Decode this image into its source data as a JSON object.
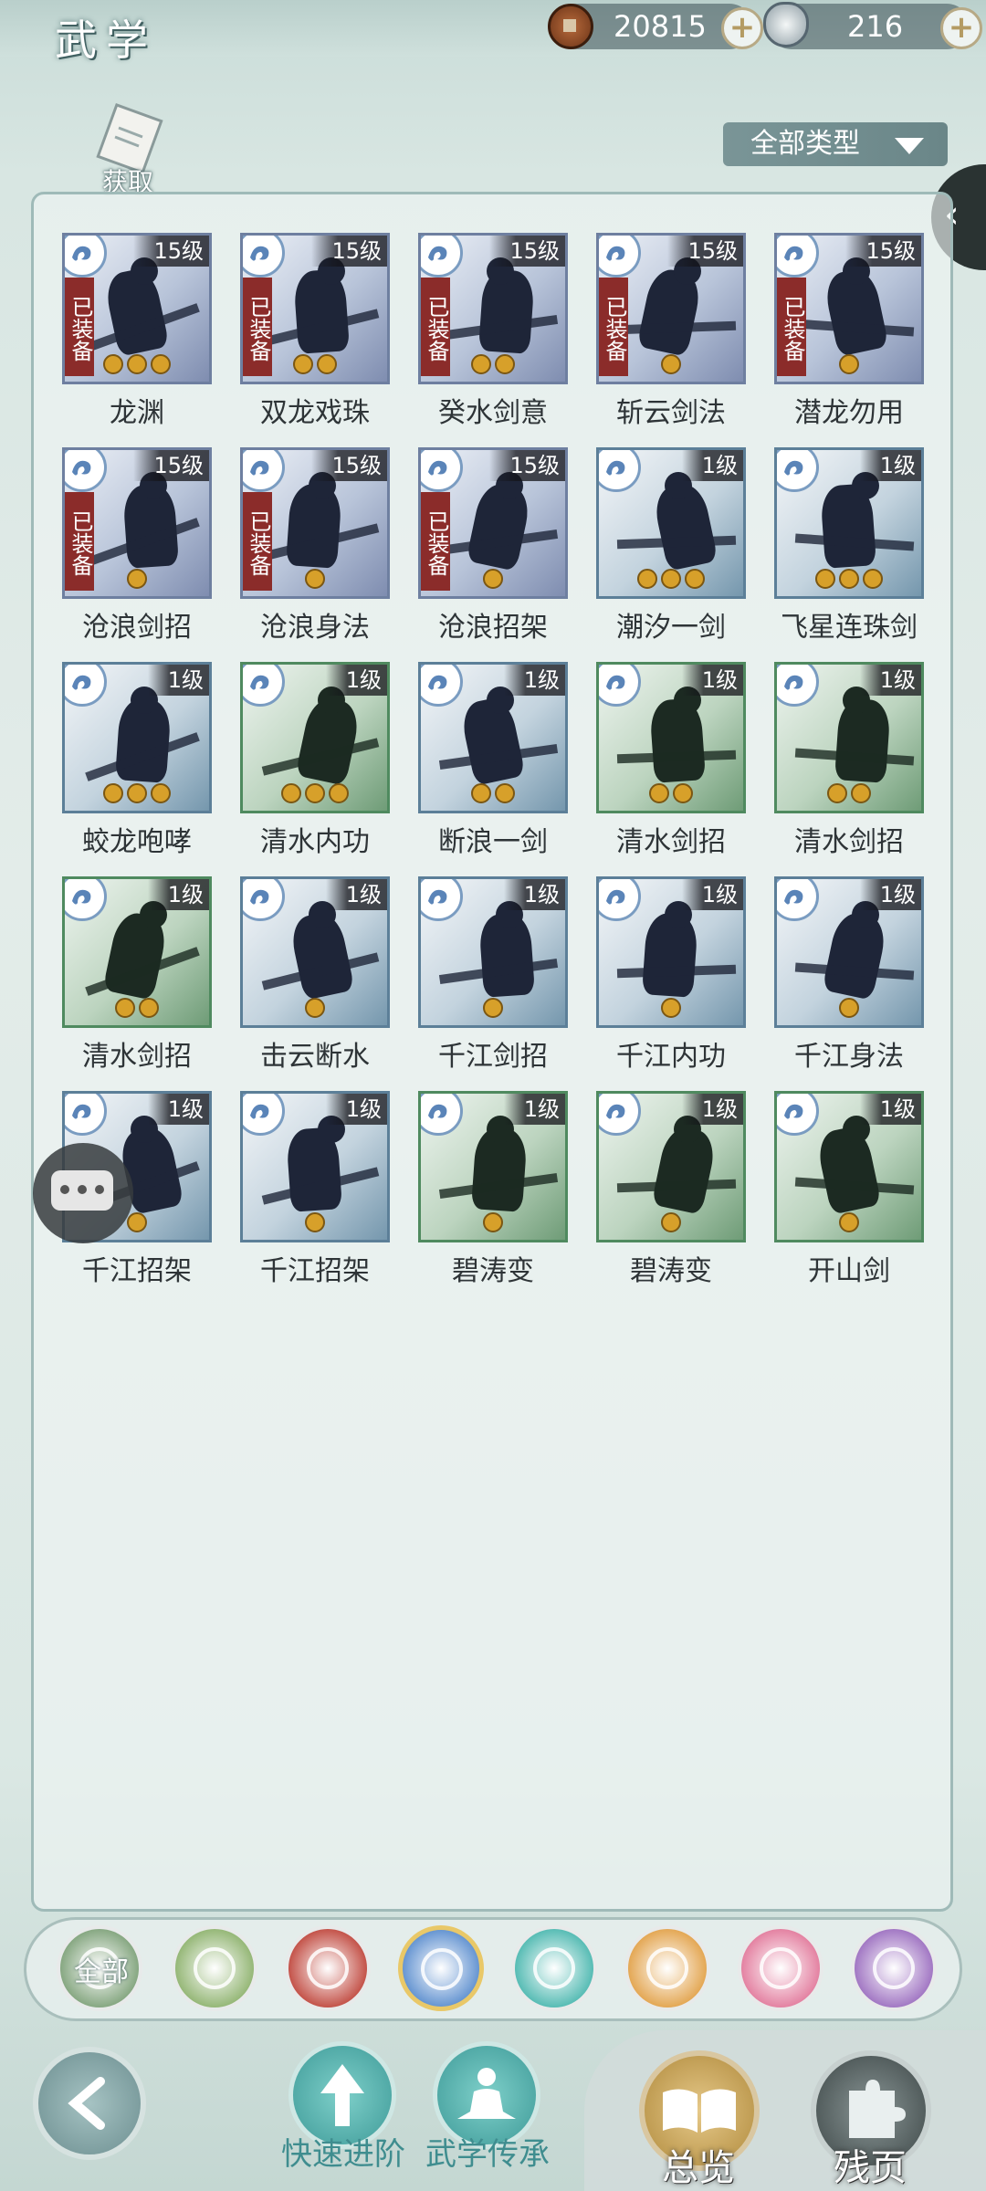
{
  "header": {
    "title": "武学",
    "coins": "20815",
    "silver": "216",
    "obtain_label": "获取",
    "filter_label": "全部类型"
  },
  "skills": [
    {
      "name": "龙渊",
      "level": "15级",
      "equipped": "已装备",
      "stars": 3,
      "theme": "blue"
    },
    {
      "name": "双龙戏珠",
      "level": "15级",
      "equipped": "已装备",
      "stars": 2,
      "theme": "blue"
    },
    {
      "name": "癸水剑意",
      "level": "15级",
      "equipped": "已装备",
      "stars": 2,
      "theme": "blue"
    },
    {
      "name": "斩云剑法",
      "level": "15级",
      "equipped": "已装备",
      "stars": 1,
      "theme": "blue"
    },
    {
      "name": "潜龙勿用",
      "level": "15级",
      "equipped": "已装备",
      "stars": 1,
      "theme": "blue"
    },
    {
      "name": "沧浪剑招",
      "level": "15级",
      "equipped": "已装备",
      "stars": 1,
      "theme": "blue"
    },
    {
      "name": "沧浪身法",
      "level": "15级",
      "equipped": "已装备",
      "stars": 1,
      "theme": "blue"
    },
    {
      "name": "沧浪招架",
      "level": "15级",
      "equipped": "已装备",
      "stars": 1,
      "theme": "blue"
    },
    {
      "name": "潮汐一剑",
      "level": "1级",
      "equipped": "",
      "stars": 3,
      "theme": "blue2"
    },
    {
      "name": "飞星连珠剑",
      "level": "1级",
      "equipped": "",
      "stars": 3,
      "theme": "blue2"
    },
    {
      "name": "蛟龙咆哮",
      "level": "1级",
      "equipped": "",
      "stars": 3,
      "theme": "blue2"
    },
    {
      "name": "清水内功",
      "level": "1级",
      "equipped": "",
      "stars": 3,
      "theme": "green"
    },
    {
      "name": "断浪一剑",
      "level": "1级",
      "equipped": "",
      "stars": 2,
      "theme": "blue2"
    },
    {
      "name": "清水剑招",
      "level": "1级",
      "equipped": "",
      "stars": 2,
      "theme": "green"
    },
    {
      "name": "清水剑招",
      "level": "1级",
      "equipped": "",
      "stars": 2,
      "theme": "green"
    },
    {
      "name": "清水剑招",
      "level": "1级",
      "equipped": "",
      "stars": 2,
      "theme": "green"
    },
    {
      "name": "击云断水",
      "level": "1级",
      "equipped": "",
      "stars": 1,
      "theme": "blue2"
    },
    {
      "name": "千江剑招",
      "level": "1级",
      "equipped": "",
      "stars": 1,
      "theme": "blue2"
    },
    {
      "name": "千江内功",
      "level": "1级",
      "equipped": "",
      "stars": 1,
      "theme": "blue2"
    },
    {
      "name": "千江身法",
      "level": "1级",
      "equipped": "",
      "stars": 1,
      "theme": "blue2"
    },
    {
      "name": "千江招架",
      "level": "1级",
      "equipped": "",
      "stars": 1,
      "theme": "blue2"
    },
    {
      "name": "千江招架",
      "level": "1级",
      "equipped": "",
      "stars": 1,
      "theme": "blue2"
    },
    {
      "name": "碧涛变",
      "level": "1级",
      "equipped": "",
      "stars": 1,
      "theme": "green"
    },
    {
      "name": "碧涛变",
      "level": "1级",
      "equipped": "",
      "stars": 1,
      "theme": "green"
    },
    {
      "name": "开山剑",
      "level": "1级",
      "equipped": "",
      "stars": 1,
      "theme": "green"
    }
  ],
  "element_filters": [
    {
      "label": "全部",
      "icon": "all-filter-icon",
      "color": "#7fa27a",
      "selected": false
    },
    {
      "label": "",
      "icon": "sword-filter-icon",
      "color": "#8fb36f",
      "selected": false
    },
    {
      "label": "",
      "icon": "fire-filter-icon",
      "color": "#c0483e",
      "selected": false
    },
    {
      "label": "",
      "icon": "water-filter-icon",
      "color": "#5d8fcf",
      "selected": true
    },
    {
      "label": "",
      "icon": "butterfly-filter-icon",
      "color": "#4db8b0",
      "selected": false
    },
    {
      "label": "",
      "icon": "shield-filter-icon",
      "color": "#e2a24a",
      "selected": false
    },
    {
      "label": "",
      "icon": "moon-filter-icon",
      "color": "#e27a9c",
      "selected": false
    },
    {
      "label": "",
      "icon": "rose-filter-icon",
      "color": "#9c6fc0",
      "selected": false
    }
  ],
  "bottom_nav": {
    "quick_advance": "快速进阶",
    "inherit": "武学传承",
    "overview": "总览",
    "fragments": "残页"
  },
  "colors": {
    "equipped_badge": "#8b2c2a",
    "teal_label": "#3f8d8f",
    "star": "#d7a02a"
  }
}
